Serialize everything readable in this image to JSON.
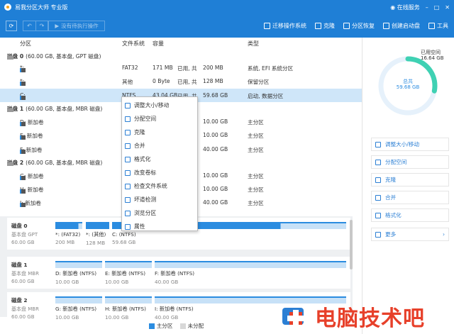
{
  "title_bar": {
    "app_name": "易我分区大师 专业版",
    "online_service": "在线服务",
    "min": "–",
    "max": "□",
    "close": "✕"
  },
  "toolbar": {
    "apply_label": "没有待执行操作",
    "tools": [
      {
        "label": "迁移操作系统",
        "icon": "migrate-os-icon"
      },
      {
        "label": "克隆",
        "icon": "clone-icon"
      },
      {
        "label": "分区恢复",
        "icon": "recovery-icon"
      },
      {
        "label": "创建启动盘",
        "icon": "bootdisk-icon"
      },
      {
        "label": "工具",
        "icon": "tools-icon"
      }
    ]
  },
  "columns": {
    "partition": "分区",
    "fs": "文件系统",
    "capacity": "容量",
    "type": "类型"
  },
  "rows": [
    {
      "kind": "disk",
      "name": "磁盘 0",
      "info": "(60.00 GB, 基本盘, GPT 磁盘)"
    },
    {
      "kind": "part",
      "name": "*:",
      "fs": "FAT32",
      "used": "171 MB",
      "used_label": "已用, 共",
      "total": "200 MB",
      "type": "系统, EFI 系统分区"
    },
    {
      "kind": "part",
      "name": "*:",
      "fs": "其他",
      "used": "0 Byte",
      "used_label": "已用, 共",
      "total": "128 MB",
      "type": "保留分区"
    },
    {
      "kind": "part",
      "name": "C:",
      "fs": "NTFS",
      "used": "43.04 GB",
      "used_label": "已用, 共",
      "total": "59.68 GB",
      "type": "启动, 数据分区",
      "selected": true
    },
    {
      "kind": "disk",
      "name": "磁盘 1",
      "info": "(60.00 GB, 基本盘, MBR 磁盘)"
    },
    {
      "kind": "part",
      "name": "D: 新加卷",
      "fs": "",
      "used": "",
      "used_label": "",
      "total": "10.00 GB",
      "type": "主分区"
    },
    {
      "kind": "part",
      "name": "E: 新加卷",
      "fs": "",
      "used": "",
      "used_label": "",
      "total": "10.00 GB",
      "type": "主分区"
    },
    {
      "kind": "part",
      "name": "F: 新加卷",
      "fs": "",
      "used": "",
      "used_label": "",
      "total": "40.00 GB",
      "type": "主分区"
    },
    {
      "kind": "disk",
      "name": "磁盘 2",
      "info": "(60.00 GB, 基本盘, MBR 磁盘)"
    },
    {
      "kind": "part",
      "name": "G: 新加卷",
      "fs": "",
      "used": "",
      "used_label": "",
      "total": "10.00 GB",
      "type": "主分区"
    },
    {
      "kind": "part",
      "name": "H: 新加卷",
      "fs": "",
      "used": "",
      "used_label": "",
      "total": "10.00 GB",
      "type": "主分区"
    },
    {
      "kind": "part",
      "name": "I: 新加卷",
      "fs": "",
      "used": "",
      "used_label": "",
      "total": "40.00 GB",
      "type": "主分区"
    }
  ],
  "context_menu": [
    {
      "label": "调整大小/移动",
      "icon": "resize-icon"
    },
    {
      "label": "分配空间",
      "icon": "allocate-icon"
    },
    {
      "label": "克隆",
      "icon": "clone-icon"
    },
    {
      "label": "合并",
      "icon": "merge-icon"
    },
    {
      "label": "格式化",
      "icon": "format-icon"
    },
    {
      "label": "改变卷标",
      "icon": "label-icon"
    },
    {
      "label": "检查文件系统",
      "icon": "check-fs-icon"
    },
    {
      "label": "坏道检测",
      "icon": "surface-test-icon"
    },
    {
      "label": "浏览分区",
      "icon": "explore-icon"
    },
    {
      "label": "属性",
      "icon": "properties-icon"
    }
  ],
  "disk_map": [
    {
      "name": "磁盘 0",
      "sub1": "基本盘 GPT",
      "sub2": "60.00 GB",
      "parts": [
        {
          "n": "*: (FAT32)",
          "s": "200 MB",
          "fill": 0.85
        },
        {
          "n": "*: (其他)",
          "s": "128 MB",
          "fill": 1.0
        },
        {
          "n": "C: (NTFS)",
          "s": "59.68 GB",
          "fill": 0.72
        }
      ]
    },
    {
      "name": "磁盘 1",
      "sub1": "基本盘 MBR",
      "sub2": "60.00 GB",
      "parts": [
        {
          "n": "D: 新加卷 (NTFS)",
          "s": "10.00 GB",
          "fill": 0.0
        },
        {
          "n": "E: 新加卷 (NTFS)",
          "s": "10.00 GB",
          "fill": 0.0
        },
        {
          "n": "F: 新加卷 (NTFS)",
          "s": "40.00 GB",
          "fill": 0.0
        }
      ]
    },
    {
      "name": "磁盘 2",
      "sub1": "基本盘 MBR",
      "sub2": "60.00 GB",
      "parts": [
        {
          "n": "G: 新加卷 (NTFS)",
          "s": "10.00 GB",
          "fill": 0.0
        },
        {
          "n": "H: 新加卷 (NTFS)",
          "s": "10.00 GB",
          "fill": 0.0
        },
        {
          "n": "I: 新加卷 (NTFS)",
          "s": "40.00 GB",
          "fill": 0.0
        }
      ]
    }
  ],
  "legend": {
    "primary": "主分区",
    "unallocated": "未分配"
  },
  "side_panel": {
    "free_label": "已用空间",
    "free_value": "16.64 GB",
    "total_label": "总共",
    "total_value": "59.68 GB",
    "used_fraction": 0.72,
    "actions": [
      {
        "label": "调整大小/移动",
        "icon": "resize-icon"
      },
      {
        "label": "分配空间",
        "icon": "allocate-icon"
      },
      {
        "label": "克隆",
        "icon": "clone-icon"
      },
      {
        "label": "合并",
        "icon": "merge-icon"
      },
      {
        "label": "格式化",
        "icon": "format-icon"
      },
      {
        "label": "更多",
        "icon": "more-icon"
      }
    ]
  },
  "watermark": {
    "text": "电脑技术吧"
  },
  "colors": {
    "accent": "#1f7fd6",
    "primary_partition": "#2b8ce0",
    "unallocated": "#d8d8d8",
    "watermark": "#e7402a"
  }
}
